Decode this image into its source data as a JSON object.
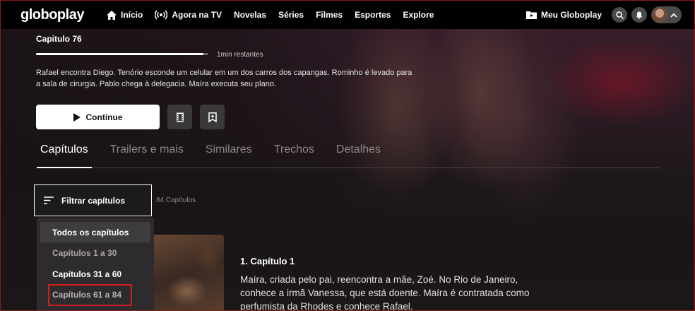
{
  "nav": {
    "logo": "globoplay",
    "items": [
      {
        "label": "Início",
        "icon": "home-icon"
      },
      {
        "label": "Agora na TV",
        "icon": "live-broadcast-icon"
      },
      {
        "label": "Novelas"
      },
      {
        "label": "Séries"
      },
      {
        "label": "Filmes"
      },
      {
        "label": "Esportes"
      },
      {
        "label": "Explore"
      }
    ],
    "my_label": "Meu Globoplay"
  },
  "hero": {
    "episode_title": "Capitulo 76",
    "remaining": "1min restantes",
    "progress": 0.97,
    "description": "Rafael encontra Diego. Tenório esconde um celular em um dos carros dos capangas. Rominho é levado para a sala de cirurgia. Pablo chega à delegacia. Maíra executa seu plano.",
    "continue_label": "Continue"
  },
  "tabs": [
    "Capítulos",
    "Trailers e mais",
    "Similares",
    "Trechos",
    "Detalhes"
  ],
  "filter": {
    "label": "Filtrar capítulos",
    "count": "84 Capítulos",
    "options": [
      "Todos os capítulos",
      "Capítulos 1 a 30",
      "Capítulos 31 a 60",
      "Capítulos 61 a 84"
    ]
  },
  "episode": {
    "title": "1. Capítulo 1",
    "description": "Maíra, criada pelo pai, reencontra a mãe, Zoé. No Rio de Janeiro, conhece a irmã Vanessa, que está doente. Maíra é contratada como perfumista da Rhodes e conhece Rafael."
  },
  "colors": {
    "nav_bg": "#000000",
    "highlight_box": "#d01f1f",
    "dropdown_bg": "#2e2b2e"
  }
}
